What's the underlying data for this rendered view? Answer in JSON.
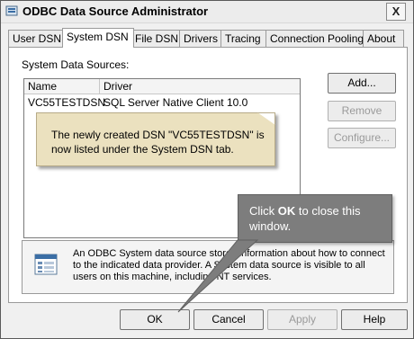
{
  "window": {
    "title": "ODBC Data Source Administrator",
    "close_glyph": "X"
  },
  "tabs": [
    {
      "label": "User DSN"
    },
    {
      "label": "System DSN"
    },
    {
      "label": "File DSN"
    },
    {
      "label": "Drivers"
    },
    {
      "label": "Tracing"
    },
    {
      "label": "Connection Pooling"
    },
    {
      "label": "About"
    }
  ],
  "active_tab": "System DSN",
  "panel": {
    "list_label": "System Data Sources:",
    "columns": {
      "name": "Name",
      "driver": "Driver"
    },
    "rows": [
      {
        "name": "VC55TESTDSN",
        "driver": "SQL Server Native Client 10.0"
      }
    ],
    "buttons": {
      "add": "Add...",
      "remove": "Remove",
      "configure": "Configure..."
    },
    "info_text": "An ODBC System data source stores information about how to connect to the indicated data provider.   A System data source is visible to all users on this machine, including NT services."
  },
  "callouts": {
    "note": "The newly created DSN \"VC55TESTDSN\" is now listed under the System DSN tab.",
    "tip_prefix": "Click ",
    "tip_bold": "OK",
    "tip_suffix": " to close this window."
  },
  "footer": {
    "ok": "OK",
    "cancel": "Cancel",
    "apply": "Apply",
    "help": "Help"
  },
  "colors": {
    "note_bg": "#ebe1bf",
    "tip_bg": "#7d7d7d",
    "disabled_text": "#9a9a9a"
  }
}
